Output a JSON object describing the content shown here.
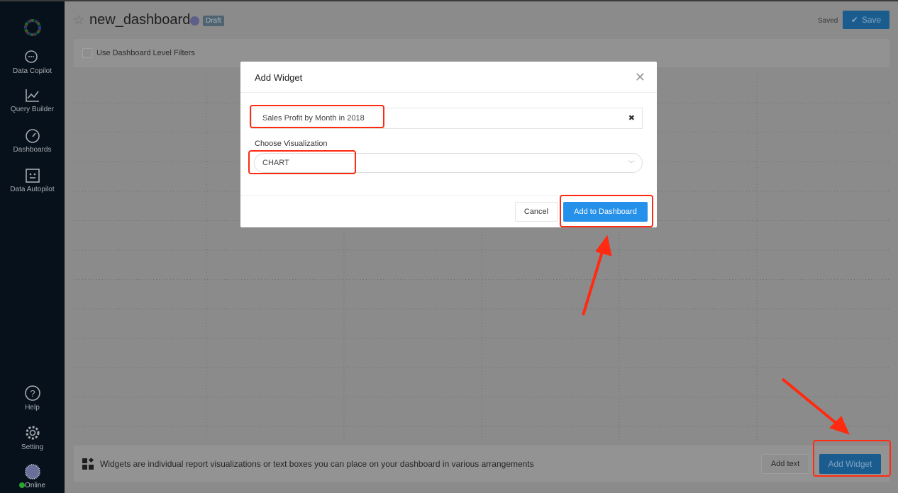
{
  "sidebar": {
    "items": [
      {
        "label": "Data Copilot",
        "icon": "chat-icon"
      },
      {
        "label": "Query Builder",
        "icon": "chart-line-icon"
      },
      {
        "label": "Dashboards",
        "icon": "gauge-icon"
      },
      {
        "label": "Data Autopilot",
        "icon": "robot-icon"
      }
    ],
    "bottom": [
      {
        "label": "Help",
        "icon": "help-icon"
      },
      {
        "label": "Setting",
        "icon": "gear-icon"
      }
    ],
    "status": "Online"
  },
  "header": {
    "title": "new_dashboard",
    "badge": "Draft",
    "saved": "Saved",
    "save_label": "Save"
  },
  "filters": {
    "label": "Use Dashboard Level Filters",
    "checked": false
  },
  "footer": {
    "hint": "Widgets are individual report visualizations or text boxes you can place on your dashboard in various arrangements",
    "add_text": "Add text",
    "add_widget": "Add Widget"
  },
  "modal": {
    "title": "Add Widget",
    "query_value": "Sales Profit by Month in 2018",
    "viz_label": "Choose Visualization",
    "viz_value": "CHART",
    "cancel": "Cancel",
    "submit": "Add to Dashboard"
  },
  "colors": {
    "accent": "#2591ea",
    "sidebar": "#07111b",
    "annotation": "#ff2a10"
  }
}
